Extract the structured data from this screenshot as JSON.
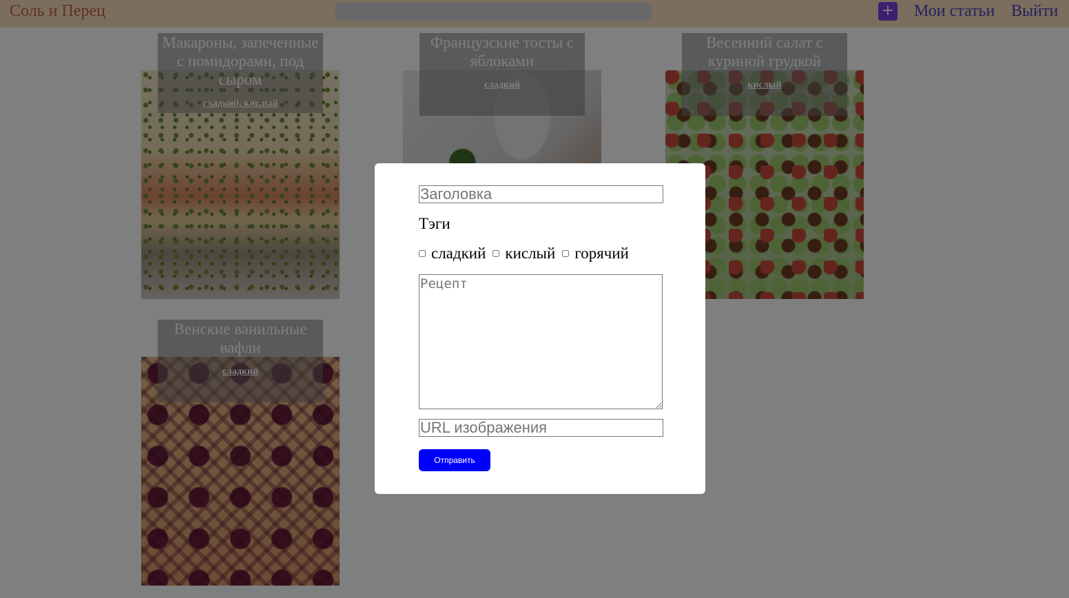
{
  "header": {
    "brand": "Соль и Перец",
    "search_placeholder": "",
    "add_label": "+",
    "nav": {
      "my_articles": "Мои статьи",
      "logout": "Выйти"
    }
  },
  "cards": [
    {
      "title": "Макароны, запеченные с помидорами, под сыром",
      "tags": [
        "сладкий",
        "кислый"
      ]
    },
    {
      "title": "Французские тосты с яблоками",
      "tags": [
        "сладкий"
      ]
    },
    {
      "title": "Весенний салат с куриной грудкой",
      "tags": [
        "кислый"
      ]
    },
    {
      "title": "Венские ванильные вафли",
      "tags": [
        "сладкий"
      ]
    }
  ],
  "modal": {
    "title_placeholder": "Заголовка",
    "tags_label": "Тэги",
    "tag_options": [
      "сладкий",
      "кислый",
      "горячий"
    ],
    "recipe_placeholder": "Рецепт",
    "image_url_placeholder": "URL изображения",
    "submit_label": "Отправить"
  },
  "colors": {
    "header_bg": "#f6dcbc",
    "brand": "#c0643a",
    "nav_link": "#4a44b8",
    "add_button": "#7a3fe0",
    "submit_button": "#0000ff"
  }
}
